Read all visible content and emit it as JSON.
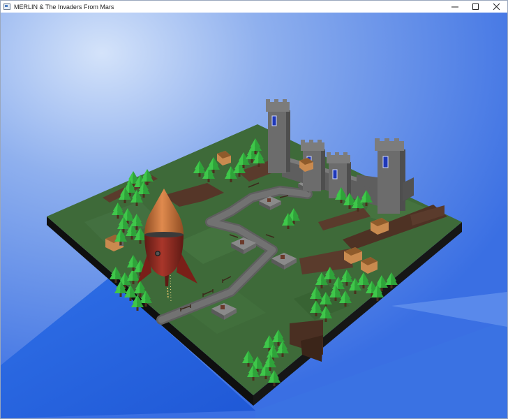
{
  "window": {
    "title": "MERLIN & The Invaders From Mars",
    "controls": {
      "minimize_icon": "minimize-icon",
      "maximize_icon": "maximize-icon",
      "close_icon": "close-icon"
    }
  },
  "scene": {
    "colors": {
      "sky_top": "#7f9fe6",
      "sky_bottom": "#3f76e6",
      "glow": "#c8daf6",
      "grass": "#3f6b3a",
      "grass_light": "#4d7a45",
      "grass_dark": "#355c30",
      "dirt": "#5a3a2a",
      "path": "#6b6b6b",
      "tower": "#6f6f6f",
      "tower_dark": "#4f4f4f",
      "window": "#2b46c9",
      "rocket_body": "#8b2a20",
      "rocket_nose": "#c4703c",
      "tree": "#2fa33a",
      "tree_light": "#3fc74a",
      "hut": "#c98a4f",
      "hut_roof": "#8f5b2b"
    }
  }
}
